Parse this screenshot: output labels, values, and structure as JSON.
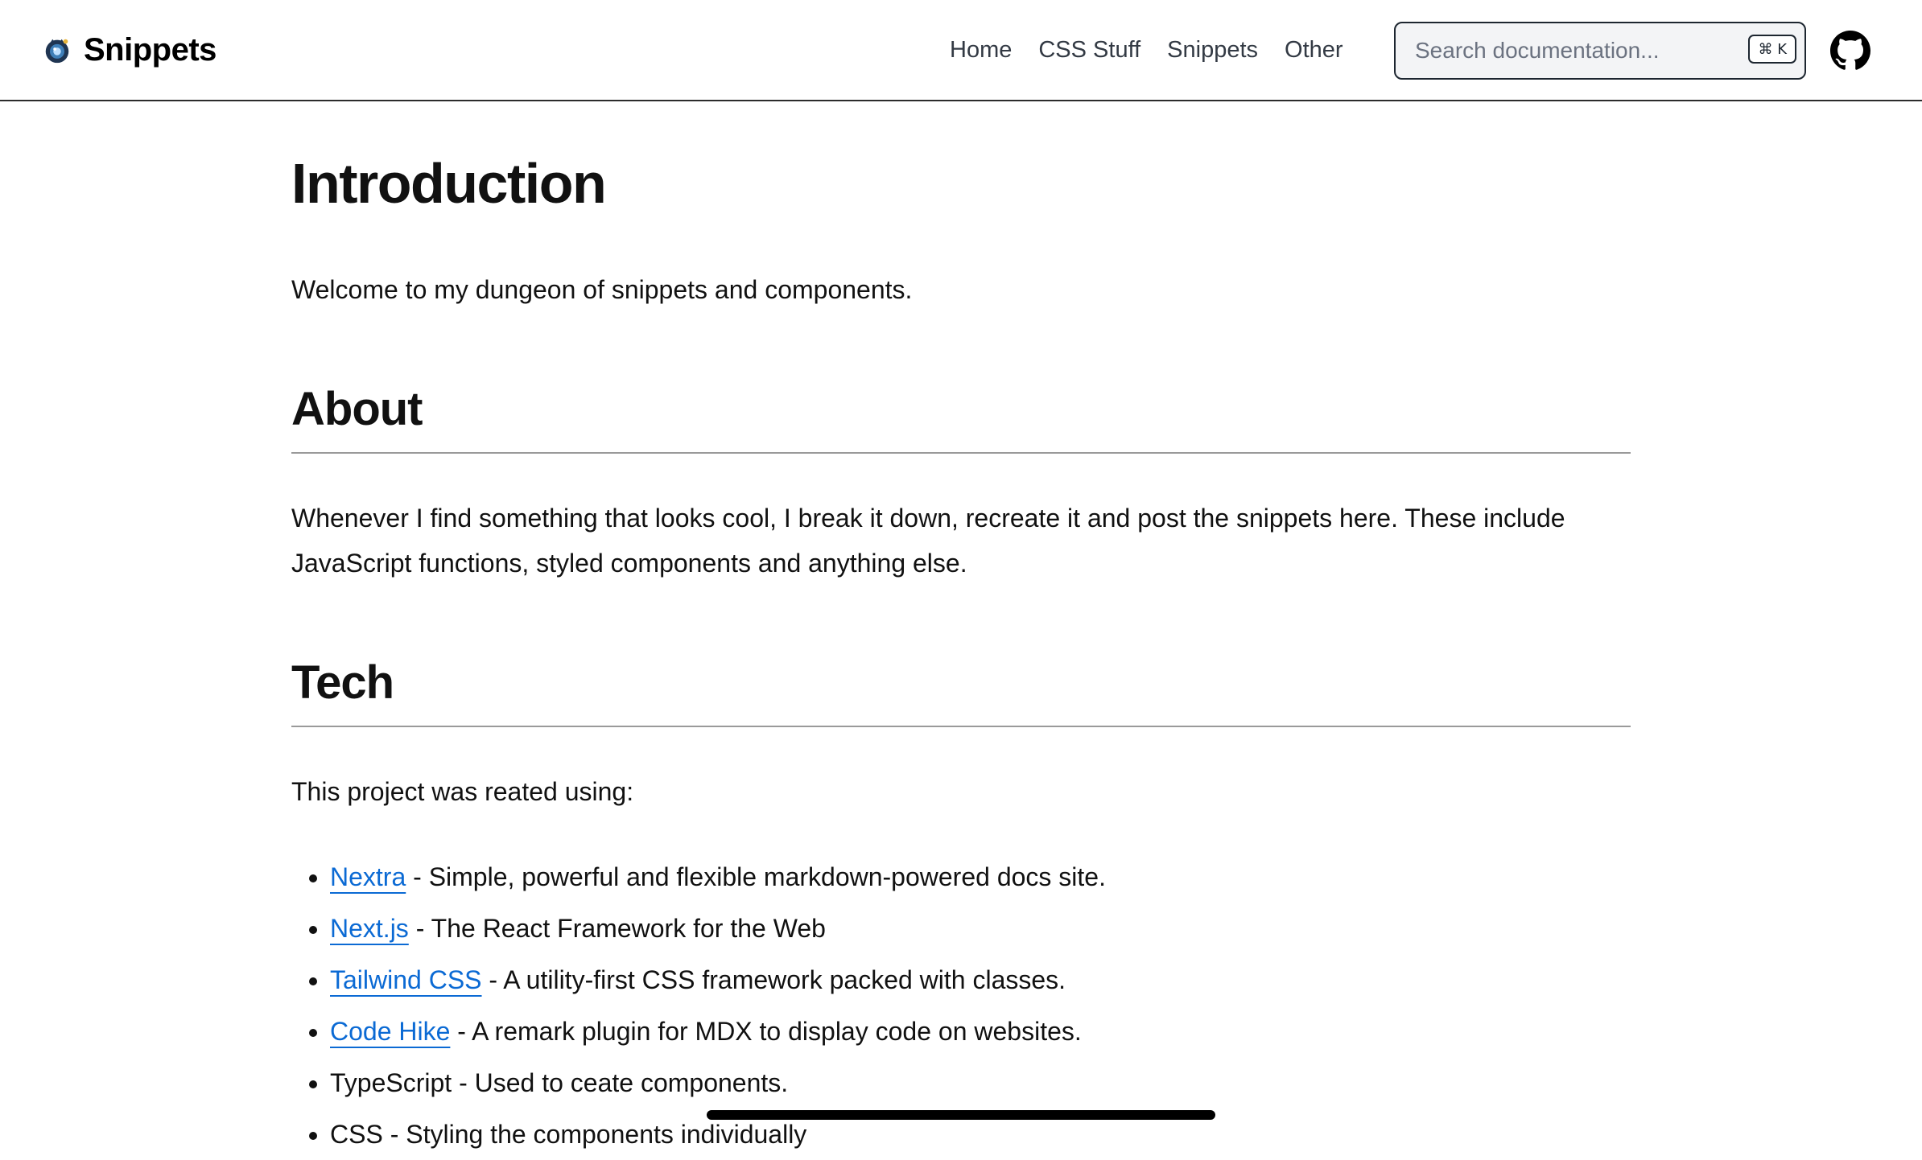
{
  "header": {
    "brand_name": "Snippets",
    "nav": [
      {
        "label": "Home"
      },
      {
        "label": "CSS Stuff"
      },
      {
        "label": "Snippets"
      },
      {
        "label": "Other"
      }
    ],
    "search": {
      "placeholder": "Search documentation...",
      "value": "",
      "shortcut": "⌘ K"
    },
    "icons": [
      "brand-logo-icon",
      "github-icon"
    ]
  },
  "main": {
    "title": "Introduction",
    "intro": "Welcome to my dungeon of snippets and components.",
    "about": {
      "heading": "About",
      "text": "Whenever I find something that looks cool, I break it down, recreate it and post the snippets here. These include JavaScript functions, styled components and anything else."
    },
    "tech": {
      "heading": "Tech",
      "lead": "This project was reated using:",
      "items": [
        {
          "link": "Nextra",
          "desc": " - Simple, powerful and flexible markdown-powered docs site."
        },
        {
          "link": "Next.js",
          "desc": " - The React Framework for the Web"
        },
        {
          "link": "Tailwind CSS",
          "desc": " - A utility-first CSS framework packed with classes."
        },
        {
          "link": "Code Hike",
          "desc": " - A remark plugin for MDX to display code on websites."
        },
        {
          "text": "TypeScript - Used to ceate components."
        },
        {
          "text": "CSS - Styling the components individually"
        }
      ]
    }
  },
  "colors": {
    "link": "#0b6ad4",
    "nav_text": "#333a44",
    "border": "#2b2b2b",
    "search_bg": "#f3f4f6"
  }
}
